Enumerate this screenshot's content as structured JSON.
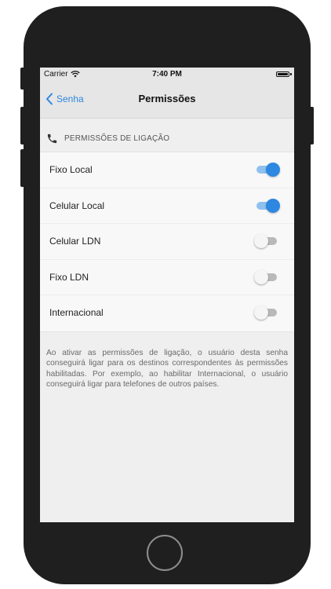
{
  "status_bar": {
    "carrier": "Carrier",
    "time": "7:40 PM"
  },
  "nav": {
    "back_label": "Senha",
    "title": "Permissões"
  },
  "section": {
    "title": "PERMISSÕES DE LIGAÇÃO",
    "icon": "phone-icon"
  },
  "permissions": [
    {
      "label": "Fixo Local",
      "enabled": true
    },
    {
      "label": "Celular Local",
      "enabled": true
    },
    {
      "label": "Celular LDN",
      "enabled": false
    },
    {
      "label": "Fixo LDN",
      "enabled": false
    },
    {
      "label": "Internacional",
      "enabled": false
    }
  ],
  "footer": {
    "text": "Ao ativar as permissões de ligação, o usuário desta senha conseguirá ligar para os destinos correspondentes às permissões habilitadas. Por exemplo, ao habilitar Internacional, o usuário conseguirá ligar para telefones de outros países."
  },
  "colors": {
    "accent": "#2e87e0",
    "toggle_on_track": "#8fc1ef",
    "toggle_off_track": "#b9b9b9"
  }
}
